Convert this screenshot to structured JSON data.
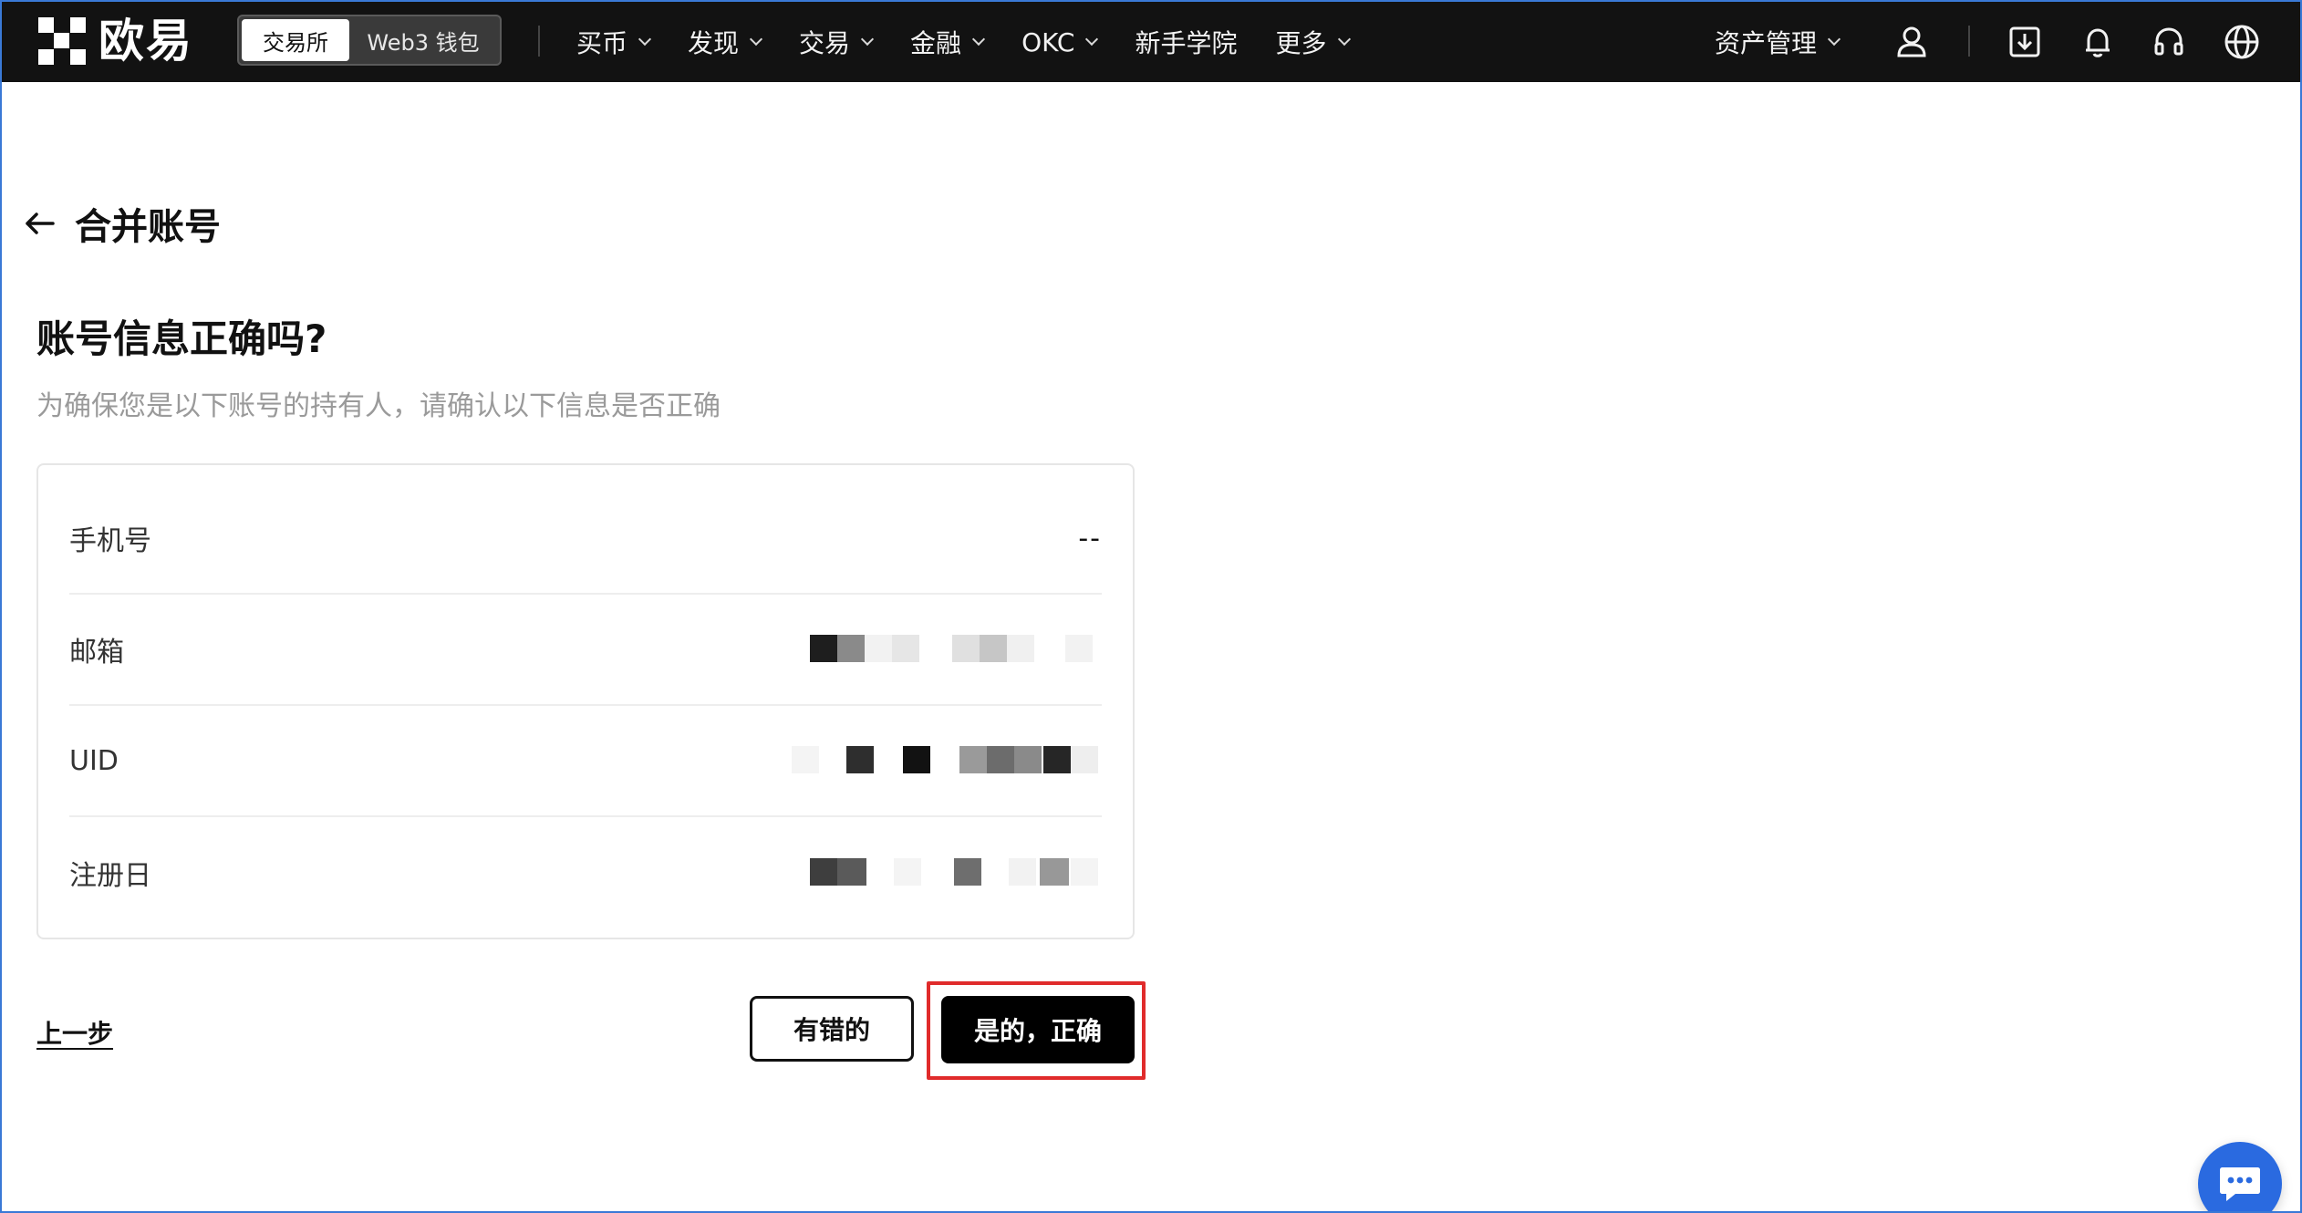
{
  "header": {
    "logo_text": "欧易",
    "segment": {
      "active": "交易所",
      "inactive": "Web3 钱包"
    },
    "nav": [
      {
        "label": "买币",
        "has_dropdown": true
      },
      {
        "label": "发现",
        "has_dropdown": true
      },
      {
        "label": "交易",
        "has_dropdown": true
      },
      {
        "label": "金融",
        "has_dropdown": true
      },
      {
        "label": "OKC",
        "has_dropdown": true
      },
      {
        "label": "新手学院",
        "has_dropdown": false
      },
      {
        "label": "更多",
        "has_dropdown": true
      }
    ],
    "asset_management": "资产管理",
    "icons": [
      "user-icon",
      "download-icon",
      "bell-icon",
      "headset-icon",
      "globe-icon"
    ]
  },
  "page": {
    "title": "合并账号",
    "heading": "账号信息正确吗?",
    "subtext": "为确保您是以下账号的持有人，请确认以下信息是否正确"
  },
  "account_info": {
    "rows": [
      {
        "label": "手机号",
        "value": "--"
      },
      {
        "label": "邮箱",
        "value": ""
      },
      {
        "label": "UID",
        "value": ""
      },
      {
        "label": "注册日",
        "value": ""
      }
    ]
  },
  "actions": {
    "prev": "上一步",
    "wrong": "有错的",
    "correct": "是的，正确"
  },
  "colors": {
    "nav_bg": "#121212",
    "highlight": "#e02b2b",
    "chat_button": "#2a6ae0",
    "primary_button": "#000000"
  }
}
